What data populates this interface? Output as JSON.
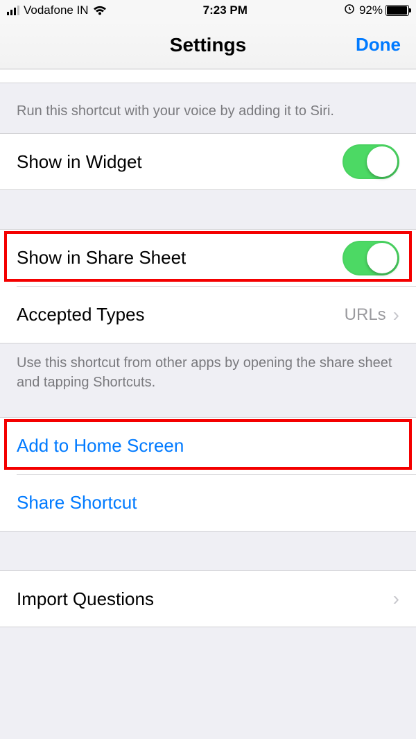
{
  "statusBar": {
    "carrier": "Vodafone IN",
    "time": "7:23 PM",
    "batteryPercent": "92%"
  },
  "nav": {
    "title": "Settings",
    "done": "Done"
  },
  "siriFooter": "Run this shortcut with your voice by adding it to Siri.",
  "widget": {
    "label": "Show in Widget"
  },
  "shareSheet": {
    "label": "Show in Share Sheet"
  },
  "acceptedTypes": {
    "label": "Accepted Types",
    "value": "URLs"
  },
  "shareFooter": "Use this shortcut from other apps by opening the share sheet and tapping Shortcuts.",
  "addHome": "Add to Home Screen",
  "shareShortcut": "Share Shortcut",
  "importQuestions": "Import Questions"
}
